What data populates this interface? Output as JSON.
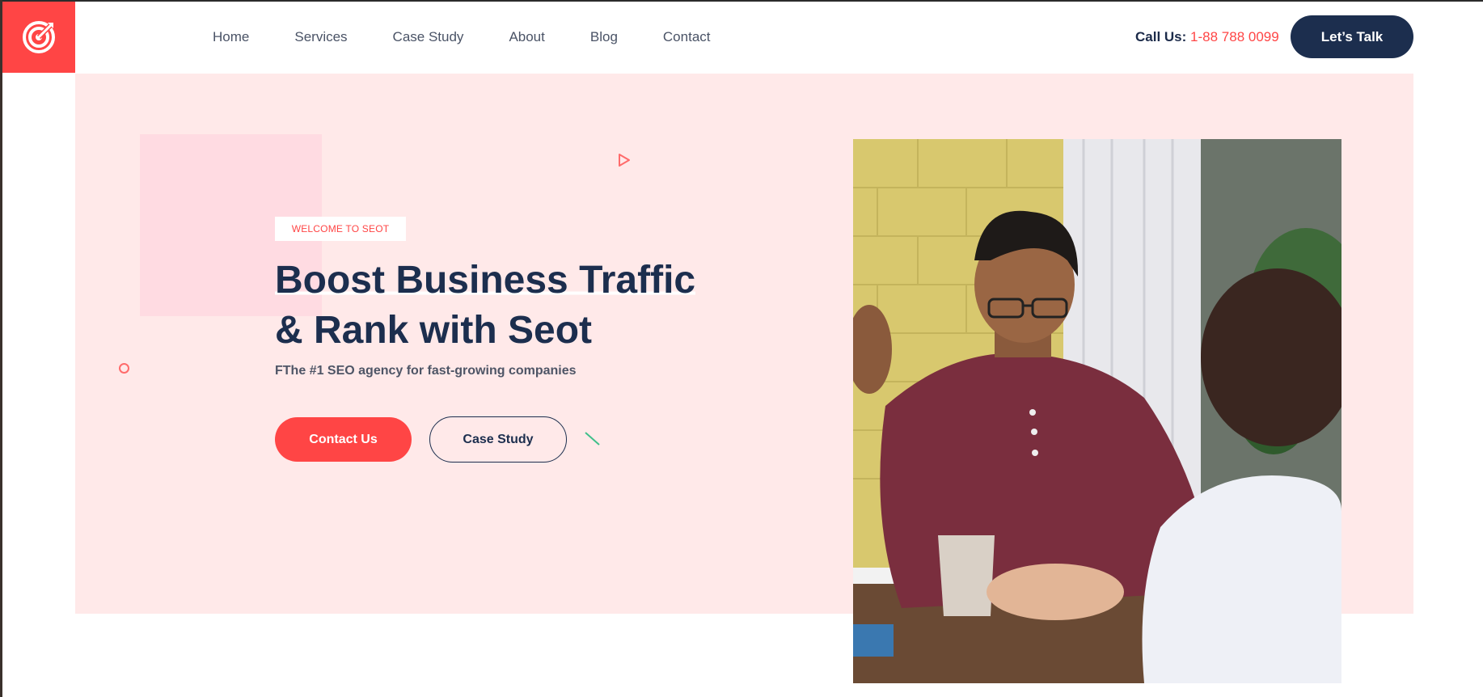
{
  "nav": {
    "items": [
      {
        "label": "Home"
      },
      {
        "label": "Services"
      },
      {
        "label": "Case Study"
      },
      {
        "label": "About"
      },
      {
        "label": "Blog"
      },
      {
        "label": "Contact"
      }
    ]
  },
  "header": {
    "call_label": "Call Us:",
    "call_number": "1-88 788 0099",
    "talk_button": "Let’s Talk"
  },
  "hero": {
    "badge": "WELCOME TO SEOT",
    "headline_line1": "Boost Business Traffic",
    "headline_line2": "& Rank with Seot",
    "subtitle": "FThe #1 SEO agency for fast-growing companies",
    "contact_button": "Contact Us",
    "case_button": "Case Study"
  },
  "colors": {
    "accent": "#ff4545",
    "navy": "#1c2e4e",
    "hero_bg": "#ffe9e9"
  },
  "icons": {
    "logo": "target-icon",
    "play": "play-outline-icon"
  }
}
